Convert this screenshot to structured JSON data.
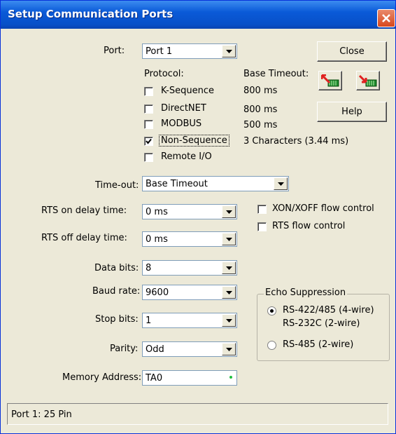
{
  "window": {
    "title": "Setup Communication Ports"
  },
  "port": {
    "label": "Port:",
    "value": "Port 1"
  },
  "buttons": {
    "close": "Close",
    "help": "Help"
  },
  "protocol": {
    "header": "Protocol:",
    "timeout_header": "Base Timeout:",
    "items": [
      {
        "label": "K-Sequence",
        "checked": false,
        "timeout": "800 ms"
      },
      {
        "label": "DirectNET",
        "checked": false,
        "timeout": "800 ms"
      },
      {
        "label": "MODBUS",
        "checked": false,
        "timeout": "500 ms"
      },
      {
        "label": "Non-Sequence",
        "checked": true,
        "timeout": "3 Characters (3.44 ms)"
      },
      {
        "label": "Remote I/O",
        "checked": false,
        "timeout": ""
      }
    ]
  },
  "timeout": {
    "label": "Time-out:",
    "value": "Base Timeout"
  },
  "rts_on": {
    "label": "RTS on delay time:",
    "value": "0 ms"
  },
  "rts_off": {
    "label": "RTS off delay time:",
    "value": "0 ms"
  },
  "flow": {
    "xon_label": "XON/XOFF flow control",
    "xon_checked": false,
    "rts_label": "RTS flow control",
    "rts_checked": false
  },
  "data_bits": {
    "label": "Data bits:",
    "value": "8"
  },
  "baud_rate": {
    "label": "Baud rate:",
    "value": "9600"
  },
  "stop_bits": {
    "label": "Stop bits:",
    "value": "1"
  },
  "parity": {
    "label": "Parity:",
    "value": "Odd"
  },
  "memory": {
    "label": "Memory Address:",
    "value": "TA0"
  },
  "echo": {
    "legend": "Echo Suppression",
    "options": [
      {
        "line1": "RS-422/485 (4-wire)",
        "line2": "RS-232C (2-wire)",
        "selected": true
      },
      {
        "line1": "RS-485 (2-wire)",
        "line2": "",
        "selected": false
      }
    ]
  },
  "status": {
    "text": "Port 1: 25 Pin"
  },
  "colors": {
    "titlebar": "#0a5ad8",
    "face": "#ece9d8",
    "close_red": "#d8471c",
    "icon_red": "#e02020",
    "icon_green": "#1c8a2c"
  }
}
